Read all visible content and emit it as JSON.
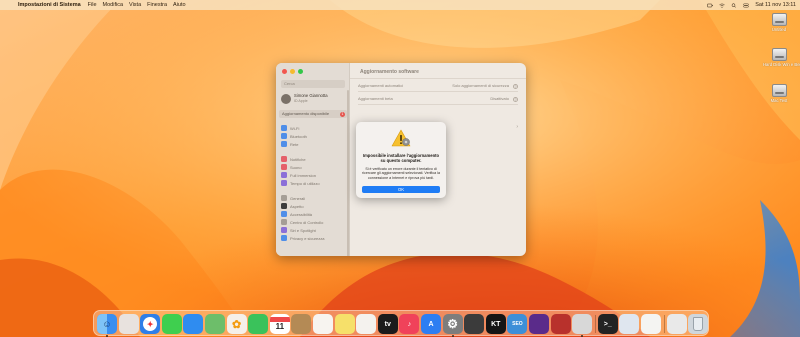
{
  "menubar": {
    "app_name": "Impostazioni di Sistema",
    "menus": [
      "File",
      "Modifica",
      "Vista",
      "Finestra",
      "Aiuto"
    ],
    "clock": "Sat 11 nov  13:11"
  },
  "desktop": {
    "drives": [
      {
        "label": "Untitled"
      },
      {
        "label": "Hard Disk Win e Bench"
      },
      {
        "label": "Mac Test"
      }
    ]
  },
  "settings_window": {
    "sidebar": {
      "search_placeholder": "Cerca",
      "user_name": "Simone Giannotta",
      "user_sub": "ID Apple",
      "update_label": "Aggiornamento disponibile",
      "update_badge": "1",
      "group1": [
        "Wi-Fi",
        "Bluetooth",
        "Rete"
      ],
      "group2": [
        "Notifiche",
        "Suono",
        "Full immersion",
        "Tempo di utilizzo"
      ],
      "group3": [
        "Generali",
        "Aspetto",
        "Accessibilità",
        "Centro di Controllo",
        "Siri e Spotlight",
        "Privacy e sicurezza"
      ]
    },
    "content": {
      "title": "Aggiornamento software",
      "row1_label": "Aggiornamenti automatici",
      "row1_value": "Solo aggiornamenti di sicurezza",
      "row2_label": "Aggiornamenti beta",
      "row2_value": "Disattivato",
      "help_glyph": "?"
    }
  },
  "alert": {
    "title": "Impossibile installare l'aggiornamento su questo computer.",
    "message": "Si è verificato un errore durante il tentativo di ricercare gli aggiornamenti selezionati. Verifica la connessione a Internet e riprova più tardi.",
    "ok_label": "OK"
  },
  "dock": {
    "calendar_day": "11",
    "apps": [
      {
        "name": "finder-icon",
        "color": "#3a8ef0",
        "glyph": ""
      },
      {
        "name": "launchpad-icon",
        "color": "#e8e2de",
        "glyph": ""
      },
      {
        "name": "safari-icon",
        "color": "#2f7fe8",
        "glyph": ""
      },
      {
        "name": "messages-icon",
        "color": "#3fcf4f",
        "glyph": ""
      },
      {
        "name": "mail-icon",
        "color": "#2f8cf0",
        "glyph": ""
      },
      {
        "name": "maps-icon",
        "color": "#6dbe6a",
        "glyph": ""
      },
      {
        "name": "photos-icon",
        "color": "#f5f0ea",
        "glyph": ""
      },
      {
        "name": "facetime-icon",
        "color": "#3ac25b",
        "glyph": ""
      },
      {
        "name": "calendar-icon",
        "color": "#ffffff",
        "glyph": ""
      },
      {
        "name": "contacts-icon",
        "color": "#b48a55",
        "glyph": ""
      },
      {
        "name": "reminders-icon",
        "color": "#f7f4f0",
        "glyph": ""
      },
      {
        "name": "notes-icon",
        "color": "#f6e06a",
        "glyph": ""
      },
      {
        "name": "freeform-icon",
        "color": "#f4f2ee",
        "glyph": ""
      },
      {
        "name": "appletv-icon",
        "color": "#1b1b1b",
        "glyph": "tv"
      },
      {
        "name": "music-icon",
        "color": "#f0425a",
        "glyph": "♪"
      },
      {
        "name": "appstore-icon",
        "color": "#2d7ef2",
        "glyph": "A"
      },
      {
        "name": "system-settings-icon",
        "color": "#7d7d7d",
        "glyph": "⚙"
      },
      {
        "name": "speedometer-icon",
        "color": "#3b3b3b",
        "glyph": ""
      },
      {
        "name": "kt-app-icon",
        "color": "#151515",
        "glyph": "KT"
      },
      {
        "name": "seo-app-icon",
        "color": "#3d8fd8",
        "glyph": "SEO"
      },
      {
        "name": "bench-app-icon",
        "color": "#5a2b8a",
        "glyph": ""
      },
      {
        "name": "red-app-icon",
        "color": "#b8312c",
        "glyph": ""
      },
      {
        "name": "disk-utility-icon",
        "color": "#d8d8d8",
        "glyph": ""
      },
      {
        "name": "terminal-icon",
        "color": "#232323",
        "glyph": ">_"
      },
      {
        "name": "preview-icon",
        "color": "#dfe6ef",
        "glyph": ""
      },
      {
        "name": "textedit-icon",
        "color": "#f4f4f2",
        "glyph": ""
      },
      {
        "name": "downloads-stack-icon",
        "color": "#e9e9e9",
        "glyph": ""
      },
      {
        "name": "trash-icon",
        "color": "#cfd6dc",
        "glyph": ""
      }
    ]
  },
  "colors": {
    "accent": "#1f7cf5",
    "close": "#f2574f",
    "minimize": "#f6bb2e",
    "maximize": "#33c748"
  }
}
